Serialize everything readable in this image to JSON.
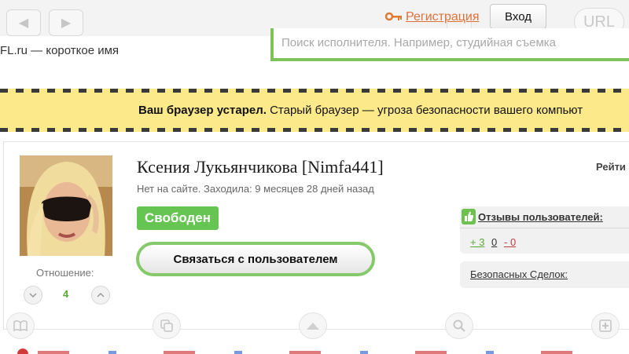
{
  "topbar": {
    "back_symbol": "◀",
    "forward_symbol": "▶",
    "url_label": "URL",
    "register_label": "Регистрация",
    "login_label": "Вход"
  },
  "header": {
    "site_name": "FL.ru — короткое имя",
    "search_placeholder": "Поиск исполнителя. Например, студийная съемка"
  },
  "warning": {
    "bold_text": "Ваш браузер устарел.",
    "text": "Старый браузер — угроза безопасности вашего компьют"
  },
  "profile": {
    "name": "Ксения Лукьянчикова [Nimfa441]",
    "last_seen": "Нет на сайте. Заходила: 9 месяцев 28 дней назад",
    "status": "Свободен",
    "contact_label": "Связаться с пользователем",
    "relation_label": "Отношение:",
    "relation_value": "4",
    "rating_label": "Рейти"
  },
  "reviews": {
    "title": "Отзывы пользователей:",
    "positive": "+ 3",
    "neutral": "0",
    "negative": "- 0"
  },
  "deals": {
    "title": "Безопасных Сделок:"
  },
  "colors": {
    "accent_green": "#66c452",
    "link_orange": "#e0703a",
    "warning_yellow": "#fce98a"
  }
}
